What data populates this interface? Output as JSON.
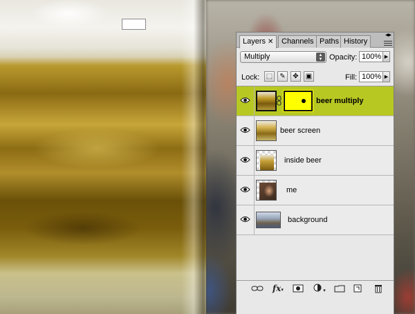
{
  "panel": {
    "tabs": [
      {
        "label": "Layers",
        "close": "✕",
        "active": true
      },
      {
        "label": "Channels",
        "active": false
      },
      {
        "label": "Paths",
        "active": false
      },
      {
        "label": "History",
        "active": false
      }
    ],
    "blend_mode": "Multiply",
    "opacity_label": "Opacity:",
    "opacity_value": "100%",
    "lock_label": "Lock:",
    "fill_label": "Fill:",
    "fill_value": "100%",
    "layers": [
      {
        "name": "beer multiply",
        "visible": true,
        "selected": true,
        "has_mask": true,
        "thumb": "beer-glass-thumbnail"
      },
      {
        "name": "beer screen",
        "visible": true,
        "selected": false,
        "has_mask": false,
        "thumb": "beer-glass-thumbnail"
      },
      {
        "name": "inside beer",
        "visible": true,
        "selected": false,
        "has_mask": false,
        "thumb": "beer-glass-thumbnail"
      },
      {
        "name": "me",
        "visible": true,
        "selected": false,
        "has_mask": false,
        "thumb": "portrait-thumbnail"
      },
      {
        "name": "background",
        "visible": true,
        "selected": false,
        "has_mask": false,
        "thumb": "street-scene-thumbnail"
      }
    ],
    "footer_icons": [
      "link-layers-icon",
      "fx-icon",
      "add-mask-icon",
      "adjustment-layer-icon",
      "new-group-icon",
      "new-layer-icon",
      "trash-icon"
    ],
    "fx_label": "fx",
    "colors": {
      "selected_row": "#b8c822",
      "mask_fill": "#ffff00"
    }
  }
}
